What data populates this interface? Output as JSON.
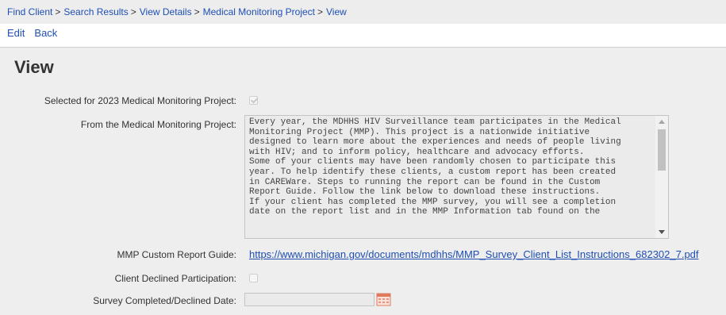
{
  "breadcrumb": {
    "items": [
      "Find Client",
      "Search Results",
      "View Details",
      "Medical Monitoring Project",
      "View"
    ],
    "separator": ">"
  },
  "actions": {
    "edit": "Edit",
    "back": "Back"
  },
  "page_title": "View",
  "fields": {
    "selected_label": "Selected for 2023 Medical Monitoring Project:",
    "selected_checked": true,
    "from_label": "From the Medical Monitoring Project:",
    "from_text": "Every year, the MDHHS HIV Surveillance team participates in the Medical\nMonitoring Project (MMP). This project is a nationwide initiative\ndesigned to learn more about the experiences and needs of people living\nwith HIV; and to inform policy, healthcare and advocacy efforts.\nSome of your clients may have been randomly chosen to participate this\nyear. To help identify these clients, a custom report has been created\nin CAREWare. Steps to running the report can be found in the Custom\nReport Guide. Follow the link below to download these instructions.\nIf your client has completed the MMP survey, you will see a completion\ndate on the report list and in the MMP Information tab found on the",
    "guide_label": "MMP Custom Report Guide:",
    "guide_link": "https://www.michigan.gov/documents/mdhhs/MMP_Survey_Client_List_Instructions_682302_7.pdf",
    "declined_label": "Client Declined Participation:",
    "declined_checked": false,
    "date_label": "Survey Completed/Declined Date:",
    "date_value": ""
  },
  "icons": {
    "calendar": "calendar-icon"
  },
  "colors": {
    "link": "#1f4fb3",
    "panel": "#eeeeee",
    "calendar": "#e07a5f"
  }
}
